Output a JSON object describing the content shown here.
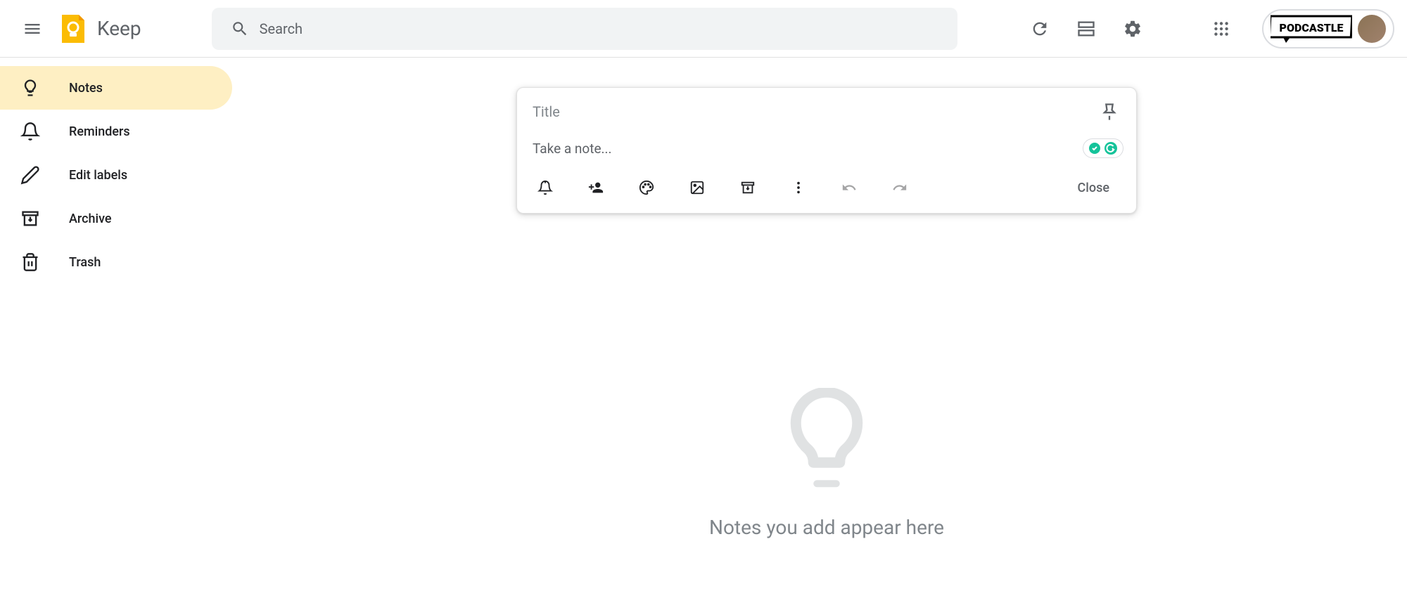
{
  "app": {
    "title": "Keep"
  },
  "search": {
    "placeholder": "Search"
  },
  "sidebar": {
    "items": [
      {
        "label": "Notes",
        "active": true
      },
      {
        "label": "Reminders",
        "active": false
      },
      {
        "label": "Edit labels",
        "active": false
      },
      {
        "label": "Archive",
        "active": false
      },
      {
        "label": "Trash",
        "active": false
      }
    ]
  },
  "note": {
    "title_placeholder": "Title",
    "body_placeholder": "Take a note...",
    "close_label": "Close"
  },
  "empty": {
    "text": "Notes you add appear here"
  },
  "extension": {
    "name": "PODCASTLE"
  }
}
